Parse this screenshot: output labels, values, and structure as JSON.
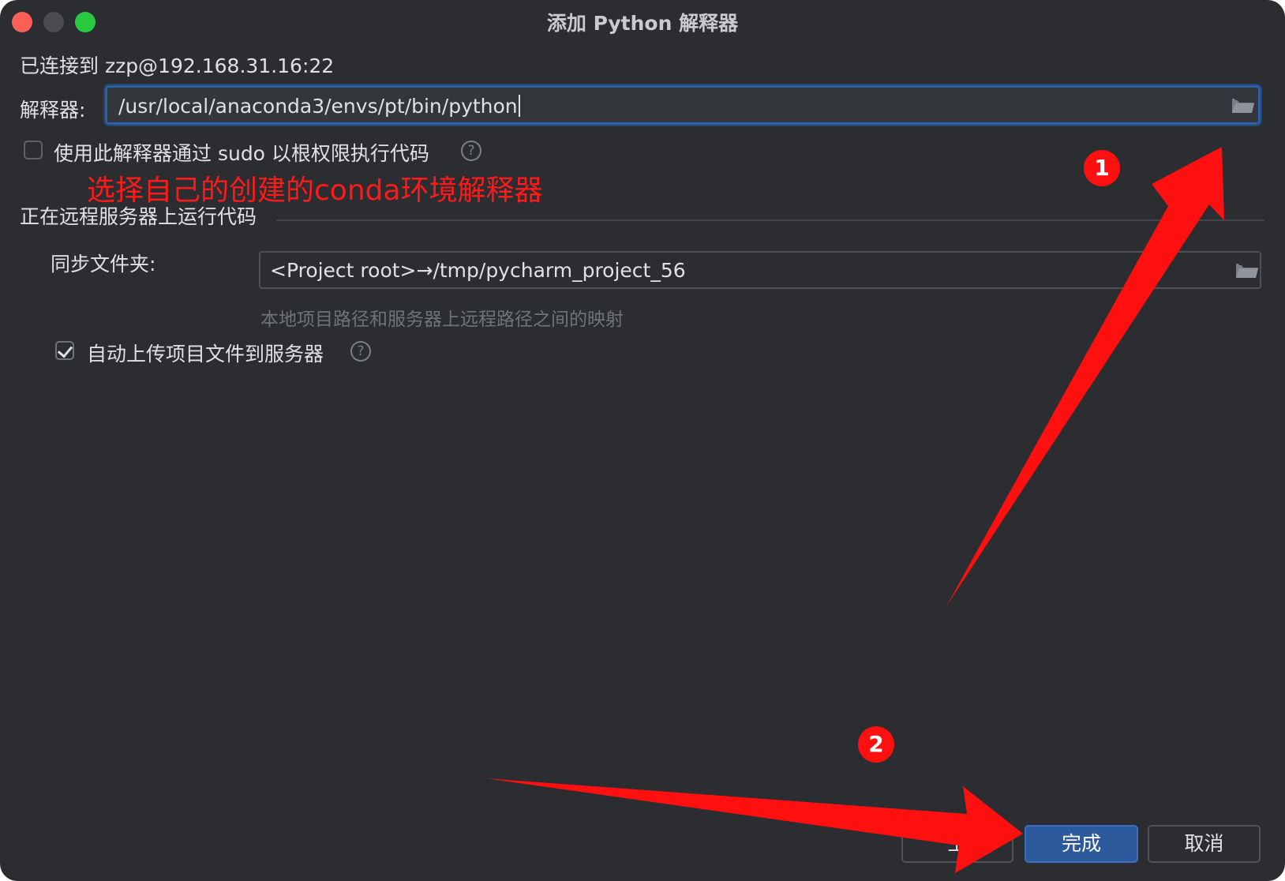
{
  "window": {
    "title": "添加 Python 解释器"
  },
  "connection": {
    "text": "已连接到 zzp@192.168.31.16:22"
  },
  "interpreter": {
    "label": "解释器:",
    "value": "/usr/local/anaconda3/envs/pt/bin/python"
  },
  "sudo_option": {
    "label": "使用此解释器通过 sudo 以根权限执行代码",
    "checked": false,
    "help": "?"
  },
  "annotation": {
    "text": "选择自己的创建的conda环境解释器",
    "badge1": "1",
    "badge2": "2",
    "color": "#ff1a1a"
  },
  "remote_section": {
    "title": "正在远程服务器上运行代码",
    "sync_label": "同步文件夹:",
    "sync_value": "<Project root>→/tmp/pycharm_project_56",
    "sync_hint": "本地项目路径和服务器上远程路径之间的映射",
    "auto_upload_label": "自动上传项目文件到服务器",
    "auto_upload_checked": true,
    "help": "?"
  },
  "buttons": {
    "previous": "上",
    "finish": "完成",
    "cancel": "取消"
  },
  "colors": {
    "background": "#2b2d30",
    "accent": "#2d5a9c",
    "annotation": "#ff1010"
  }
}
